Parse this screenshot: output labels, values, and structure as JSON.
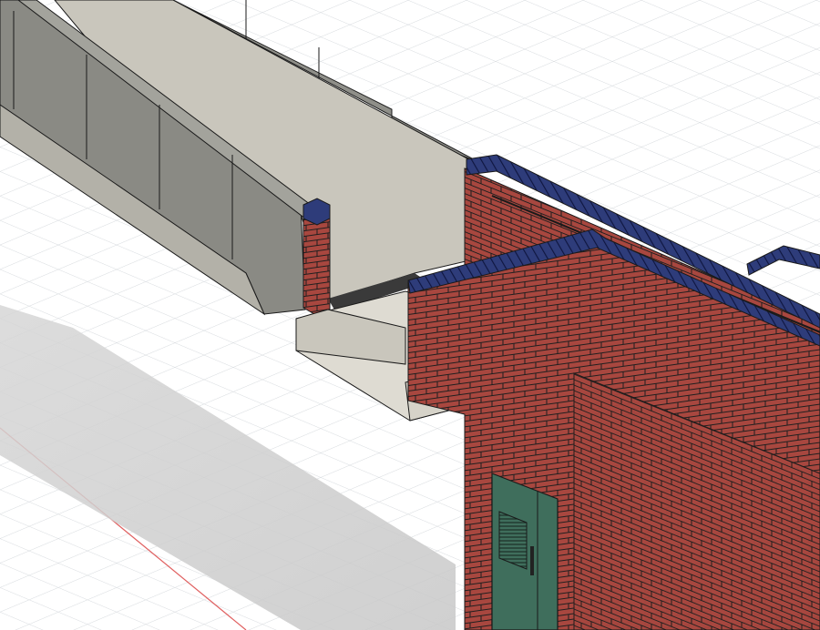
{
  "scene": {
    "colors": {
      "background": "#ffffff",
      "grid_line": "#d4d8dc",
      "axis_line": "#e06060",
      "shadow": "#cfcfcf",
      "steel_wall": "#8f8f89",
      "steel_wall_dark": "#7b7b75",
      "steel_wall_light": "#a3a39c",
      "deck": "#c9c6bc",
      "deck_light": "#dedbd2",
      "brick": "#a8473f",
      "brick_mortar": "#1f1f1f",
      "coping": "#2e3c7a",
      "door": "#3f6e5c",
      "outline": "#1a1a1a"
    },
    "elements": [
      "ground-grid",
      "red-axis-line",
      "ground-shadow",
      "steel-bridge-wall-far",
      "steel-bridge-wall-near",
      "bridge-deck",
      "brick-pier",
      "concrete-abutment",
      "brick-building",
      "coping-bricks",
      "green-door"
    ]
  }
}
